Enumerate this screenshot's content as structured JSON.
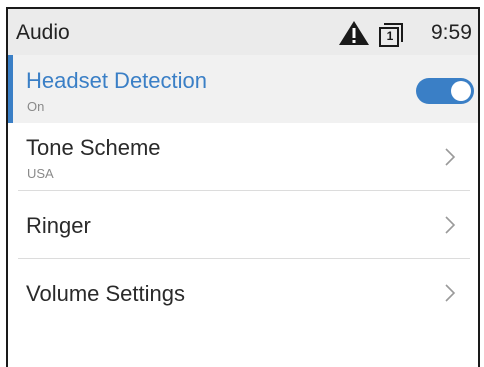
{
  "status_bar": {
    "title": "Audio",
    "line_number": "1",
    "time": "9:59",
    "icons": [
      "warning-icon",
      "line-key-icon"
    ]
  },
  "menu": {
    "items": [
      {
        "label": "Headset Detection",
        "value": "On",
        "control": "toggle",
        "toggle_on": true,
        "selected": true
      },
      {
        "label": "Tone Scheme",
        "value": "USA",
        "control": "chevron"
      },
      {
        "label": "Ringer",
        "value": "",
        "control": "chevron"
      },
      {
        "label": "Volume Settings",
        "value": "",
        "control": "chevron"
      }
    ]
  },
  "colors": {
    "accent": "#3a7fc6",
    "status_bar_bg": "#ebebeb",
    "selected_row_bg": "#f1f1f1",
    "text": "#2a2a2a",
    "subtext": "#8a8a8a"
  }
}
